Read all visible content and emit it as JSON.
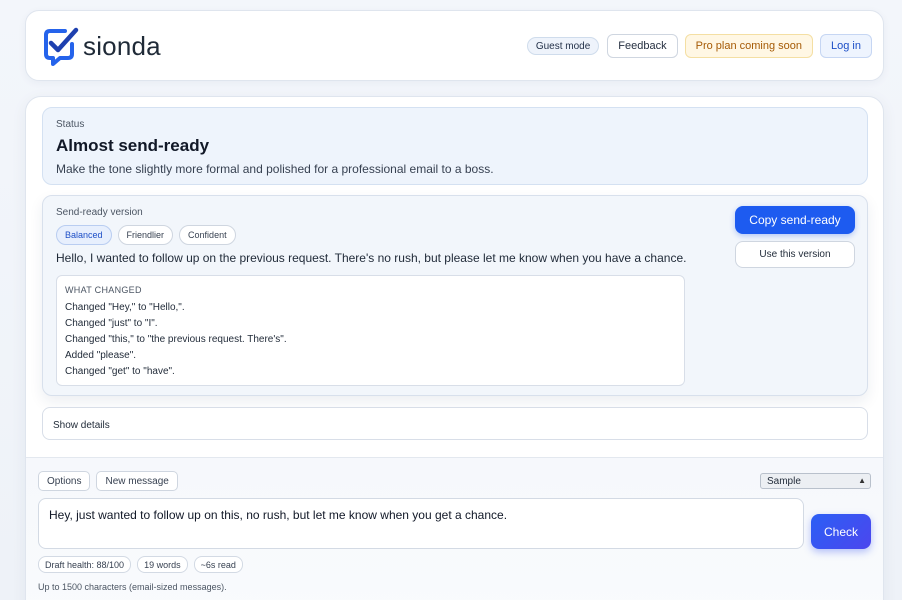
{
  "brand": {
    "name": "sionda",
    "accent": "#1d5bf0"
  },
  "header": {
    "guest_mode": "Guest mode",
    "feedback": "Feedback",
    "pro_plan": "Pro plan coming soon",
    "login": "Log in"
  },
  "status": {
    "label": "Status",
    "title": "Almost send-ready",
    "description": "Make the tone slightly more formal and polished for a professional email to a boss."
  },
  "send_ready": {
    "label": "Send-ready version",
    "tones": [
      {
        "label": "Balanced",
        "active": true
      },
      {
        "label": "Friendlier",
        "active": false
      },
      {
        "label": "Confident",
        "active": false
      }
    ],
    "text": "Hello, I wanted to follow up on the previous request. There's no rush, but please let me know when you have a chance.",
    "changes_title": "WHAT CHANGED",
    "changes": [
      "Changed \"Hey,\" to \"Hello,\".",
      "Changed \"just\" to \"I\".",
      "Changed \"this,\" to \"the previous request. There's\".",
      "Added \"please\".",
      "Changed \"get\" to \"have\"."
    ],
    "copy_button": "Copy send-ready",
    "use_button": "Use this version"
  },
  "details": {
    "label": "Show details"
  },
  "composer": {
    "options": "Options",
    "new_message": "New message",
    "select_value": "Sample",
    "draft": "Hey, just wanted to follow up on this, no rush, but let me know when you get a chance.",
    "check_button": "Check",
    "meta": [
      "Draft health: 88/100",
      "19 words",
      "~6s read"
    ],
    "footnote": "Up to 1500 characters (email-sized messages)."
  }
}
